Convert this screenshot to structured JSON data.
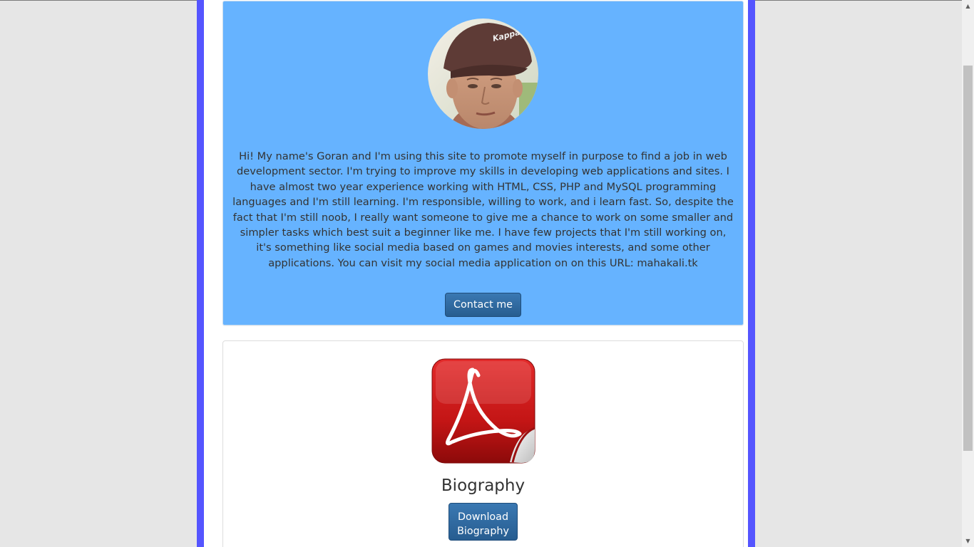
{
  "about": {
    "text": "Hi! My name's Goran and I'm using this site to promote myself in purpose to find a job in web development sector. I'm trying to improve my skills in developing web applications and sites. I have almost two year experience working with HTML, CSS, PHP and MySQL programming languages and I'm still learning. I'm responsible, willing to work, and i learn fast. So, despite the fact that I'm still noob, I really want someone to give me a chance to work on some smaller and simpler tasks which best suit a beginner like me. I have few projects that I'm still working on, it's something like social media based on games and movies interests, and some other applications. You can visit my social media application on on this URL: mahakali.tk",
    "contact_label": "Contact me",
    "avatar_icon": "profile-photo",
    "cap_logo": "Kappa"
  },
  "biography": {
    "title": "Biography",
    "download_label_line1": "Download",
    "download_label_line2": "Biography",
    "icon": "pdf-document-icon"
  },
  "colors": {
    "page_background": "#e6e6e6",
    "frame_border": "#5555ff",
    "about_panel": "#66b3ff",
    "button": "#2f6ca5",
    "pdf_red": "#d01a1a"
  },
  "scrollbar": {
    "up_arrow": "▲",
    "down_arrow": "▼"
  }
}
